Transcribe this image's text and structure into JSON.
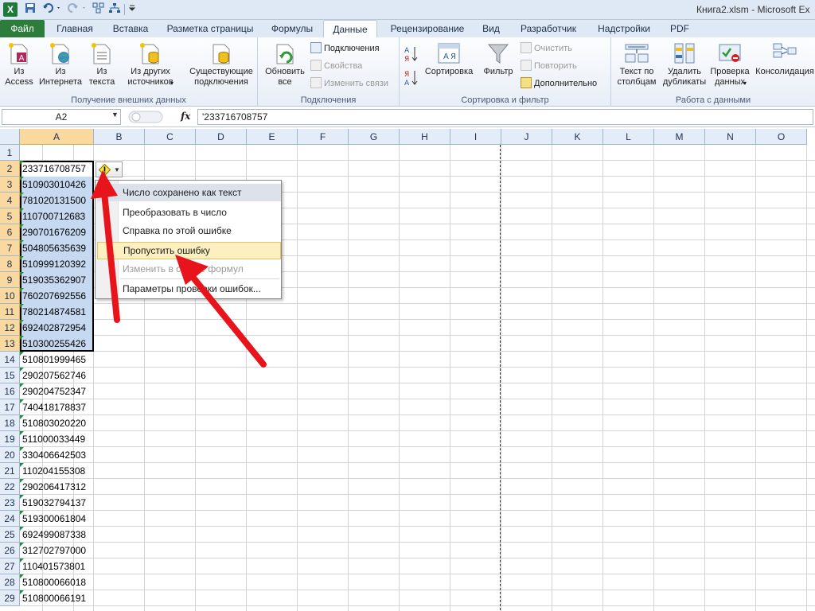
{
  "titlebar": {
    "app_letter": "X",
    "title": "Книга2.xlsm - Microsoft Ex"
  },
  "tabs": [
    {
      "label": "Файл"
    },
    {
      "label": "Главная"
    },
    {
      "label": "Вставка"
    },
    {
      "label": "Разметка страницы"
    },
    {
      "label": "Формулы"
    },
    {
      "label": "Данные"
    },
    {
      "label": "Рецензирование"
    },
    {
      "label": "Вид"
    },
    {
      "label": "Разработчик"
    },
    {
      "label": "Надстройки"
    },
    {
      "label": "PDF"
    }
  ],
  "ribbon": {
    "external": {
      "label": "Получение внешних данных",
      "access": "Из\nAccess",
      "web": "Из\nИнтернета",
      "text": "Из\nтекста",
      "other": "Из других\nисточников",
      "existing": "Существующие\nподключения"
    },
    "connections": {
      "label": "Подключения",
      "refresh": "Обновить\nвсе",
      "conn": "Подключения",
      "props": "Свойства",
      "edit_links": "Изменить связи"
    },
    "sortfilter": {
      "label": "Сортировка и фильтр",
      "sort": "Сортировка",
      "filter": "Фильтр",
      "clear": "Очистить",
      "reapply": "Повторить",
      "advanced": "Дополнительно"
    },
    "datatools": {
      "label": "Работа с данными",
      "text_to_cols": "Текст по\nстолбцам",
      "remove_dup": "Удалить\nдубликаты",
      "validation": "Проверка\nданных",
      "consolidate": "Консолидация"
    }
  },
  "formula_bar": {
    "name_box": "A2",
    "fx": "fx",
    "formula": "'233716708757"
  },
  "columns": [
    "A",
    "B",
    "C",
    "D",
    "E",
    "F",
    "G",
    "H",
    "I",
    "J",
    "K",
    "L",
    "M",
    "N",
    "O"
  ],
  "rows": [
    "1",
    "2",
    "3",
    "4",
    "5",
    "6",
    "7",
    "8",
    "9",
    "10",
    "11",
    "12",
    "13",
    "14",
    "15",
    "16",
    "17",
    "18",
    "19",
    "20",
    "21",
    "22",
    "23",
    "24",
    "25",
    "26",
    "27",
    "28",
    "29"
  ],
  "cells_A": [
    "",
    "233716708757",
    "510903010426",
    "781020131500",
    "110700712683",
    "290701676209",
    "504805635639",
    "510999120392",
    "519035362907",
    "760207692556",
    "780214874581",
    "692402872954",
    "510300255426",
    "510801999465",
    "290207562746",
    "290204752347",
    "740418178837",
    "510803020220",
    "511000033449",
    "330406642503",
    "110204155308",
    "290206417312",
    "519032794137",
    "519300061804",
    "692499087338",
    "312702797000",
    "110401573801",
    "510800066018",
    "510800066191"
  ],
  "context_menu": {
    "header": "Число сохранено как текст",
    "items": [
      {
        "label": "Преобразовать в число",
        "state": "normal"
      },
      {
        "label": "Справка по этой ошибке",
        "state": "normal"
      },
      {
        "label": "Пропустить ошибку",
        "state": "highlighted"
      },
      {
        "label": "Изменить в строке формул",
        "state": "disabled"
      },
      {
        "label": "Параметры проверки ошибок...",
        "state": "normal"
      }
    ]
  },
  "colors": {
    "file_tab": "#2c7c3c",
    "selection": "#c6d9f0",
    "header_selected": "#f9d99f",
    "arrow": "#e8141b",
    "error_triangle": "#1a8f3a"
  }
}
